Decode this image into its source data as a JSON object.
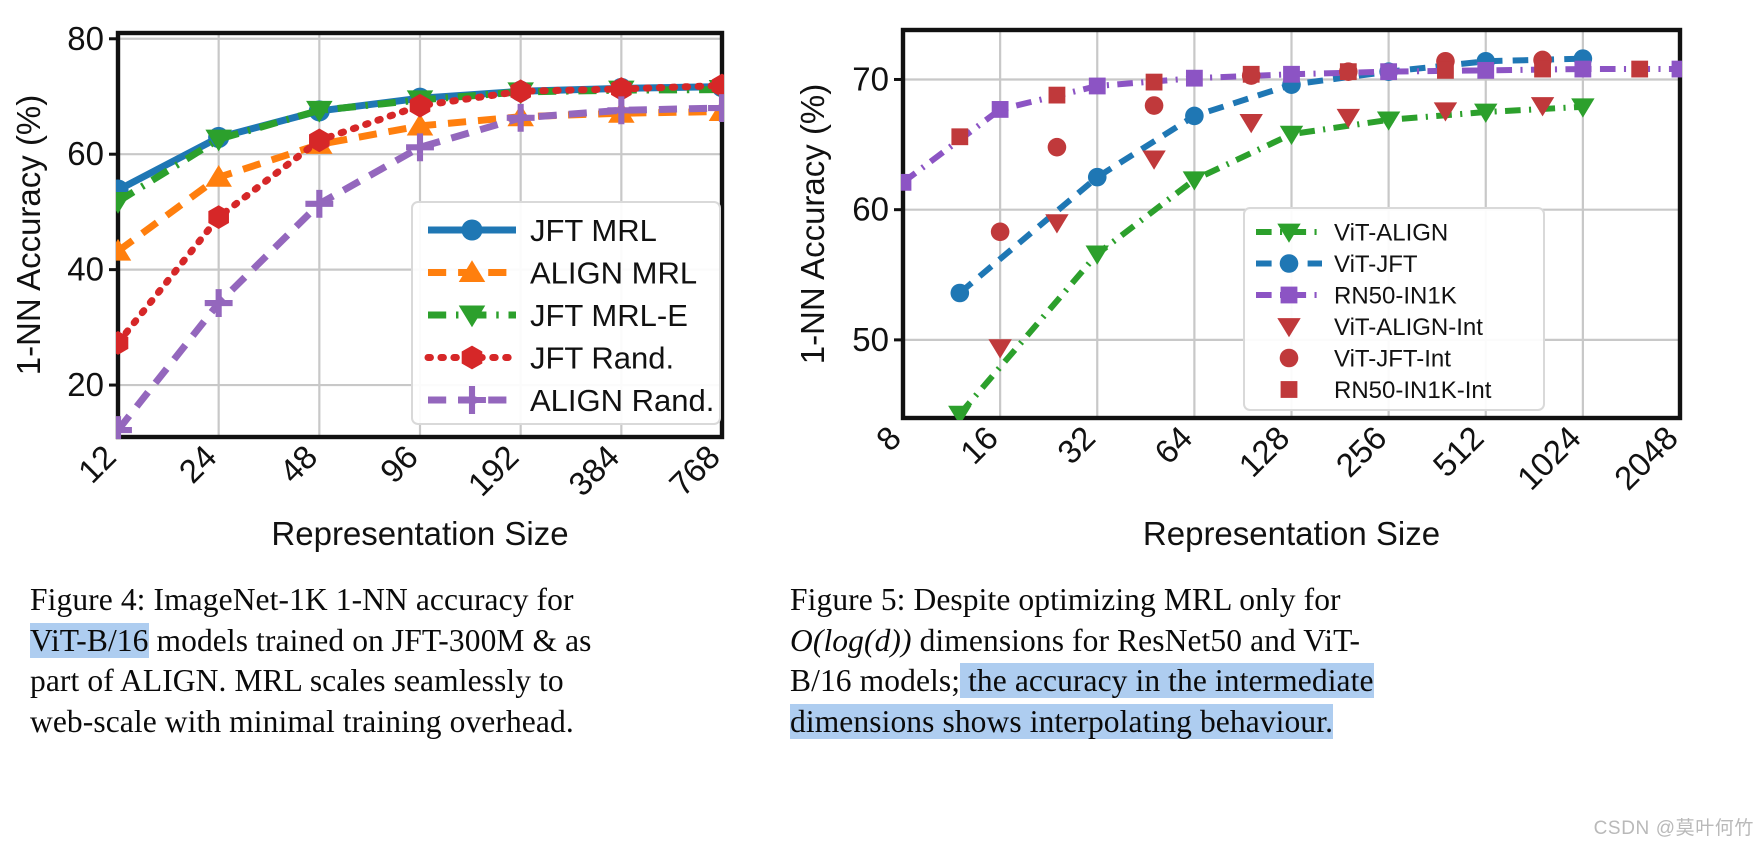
{
  "watermark": "CSDN @莫叶何竹",
  "figure4": {
    "caption_lines": [
      [
        {
          "t": "Figure 4:  ImageNet-1K 1-NN accuracy for",
          "hl": false
        }
      ],
      [
        {
          "t": "ViT-B/16",
          "hl": true
        },
        {
          "t": " models trained on JFT-300M & as",
          "hl": false
        }
      ],
      [
        {
          "t": "part of ALIGN. MRL scales seamlessly to",
          "hl": false
        }
      ],
      [
        {
          "t": "web-scale with minimal training overhead.",
          "hl": false
        }
      ]
    ],
    "chart_data": {
      "type": "line",
      "title": "",
      "xlabel": "Representation Size",
      "ylabel": "1-NN Accuracy (%)",
      "x_categories": [
        "12",
        "24",
        "48",
        "96",
        "192",
        "384",
        "768"
      ],
      "yticks": [
        20,
        40,
        60,
        80
      ],
      "ylim": [
        11,
        81
      ],
      "grid": true,
      "legend_position": "lower-right",
      "series": [
        {
          "name": "JFT MRL",
          "color": "#1f77b4",
          "marker": "circle",
          "linestyle": "solid",
          "values": [
            53.8,
            62.9,
            67.5,
            69.7,
            70.9,
            71.4,
            71.7
          ]
        },
        {
          "name": "ALIGN MRL",
          "color": "#ff7f0e",
          "marker": "triangle-up",
          "linestyle": "dashed",
          "values": [
            43.2,
            56.0,
            61.7,
            64.9,
            66.5,
            67.1,
            67.4
          ]
        },
        {
          "name": "JFT MRL-E",
          "color": "#2ca02c",
          "marker": "triangle-down",
          "linestyle": "dashdot",
          "values": [
            51.8,
            62.6,
            67.6,
            69.4,
            70.8,
            71.1,
            71.2
          ]
        },
        {
          "name": "JFT Rand.",
          "color": "#d62728",
          "marker": "hexagon",
          "linestyle": "dotted",
          "values": [
            27.3,
            49.1,
            62.4,
            68.4,
            70.9,
            71.3,
            71.9
          ]
        },
        {
          "name": "ALIGN Rand.",
          "color": "#9467bd",
          "marker": "plus",
          "linestyle": "dashed",
          "values": [
            12.2,
            34.2,
            51.4,
            61.2,
            66.3,
            67.6,
            68.0
          ]
        }
      ]
    }
  },
  "figure5": {
    "caption_lines": [
      [
        {
          "t": "Figure 5:  Despite optimizing MRL only for",
          "hl": false
        }
      ],
      [
        {
          "t": "O(log(d))",
          "hl": false,
          "math": true
        },
        {
          "t": " dimensions for ResNet50 and ViT-",
          "hl": false
        }
      ],
      [
        {
          "t": "B/16 models;",
          "hl": false
        },
        {
          "t": " the accuracy in the intermediate",
          "hl": true
        }
      ],
      [
        {
          "t": "dimensions shows interpolating behaviour.",
          "hl": true
        }
      ]
    ],
    "chart_data": {
      "type": "line",
      "title": "",
      "xlabel": "Representation Size",
      "ylabel": "1-NN Accuracy (%)",
      "x_categories": [
        "8",
        "16",
        "32",
        "64",
        "128",
        "256",
        "512",
        "1024",
        "2048"
      ],
      "yticks": [
        50,
        60,
        70
      ],
      "ylim": [
        44,
        73.8
      ],
      "grid": true,
      "legend_position": "lower-right",
      "series": [
        {
          "name": "ViT-ALIGN",
          "color": "#2ca02c",
          "marker": "triangle-down",
          "linestyle": "dashdot",
          "x": [
            12,
            32,
            64,
            128,
            256,
            512,
            1024
          ],
          "values": [
            44.3,
            56.6,
            62.3,
            65.8,
            66.9,
            67.5,
            67.9
          ]
        },
        {
          "name": "ViT-JFT",
          "color": "#1f77b4",
          "marker": "circle",
          "linestyle": "dashed",
          "x": [
            12,
            32,
            64,
            128,
            256,
            512,
            1024
          ],
          "values": [
            53.6,
            62.5,
            67.2,
            69.6,
            70.6,
            71.4,
            71.6
          ]
        },
        {
          "name": "RN50-IN1K",
          "color": "#8c54c4",
          "marker": "square",
          "linestyle": "dashdot",
          "x": [
            8,
            16,
            32,
            64,
            128,
            256,
            512,
            1024,
            2048
          ],
          "values": [
            62.1,
            67.7,
            69.5,
            70.1,
            70.4,
            70.6,
            70.7,
            70.8,
            70.8
          ]
        },
        {
          "name": "ViT-ALIGN-Int",
          "color": "#c0393b",
          "marker": "triangle-down",
          "linestyle": "none",
          "x": [
            16,
            24,
            48,
            96,
            192,
            384,
            768
          ],
          "values": [
            49.4,
            59.0,
            63.9,
            66.7,
            67.1,
            67.6,
            68.0
          ]
        },
        {
          "name": "ViT-JFT-Int",
          "color": "#c0393b",
          "marker": "circle",
          "linestyle": "none",
          "x": [
            16,
            24,
            48,
            96,
            192,
            384,
            768
          ],
          "values": [
            58.3,
            64.8,
            68.0,
            70.3,
            70.6,
            71.4,
            71.5
          ]
        },
        {
          "name": "RN50-IN1K-Int",
          "color": "#c0393b",
          "marker": "square",
          "linestyle": "none",
          "x": [
            12,
            24,
            48,
            96,
            192,
            384,
            768,
            1536
          ],
          "values": [
            65.6,
            68.8,
            69.8,
            70.4,
            70.6,
            70.7,
            70.8,
            70.8
          ]
        }
      ]
    }
  }
}
